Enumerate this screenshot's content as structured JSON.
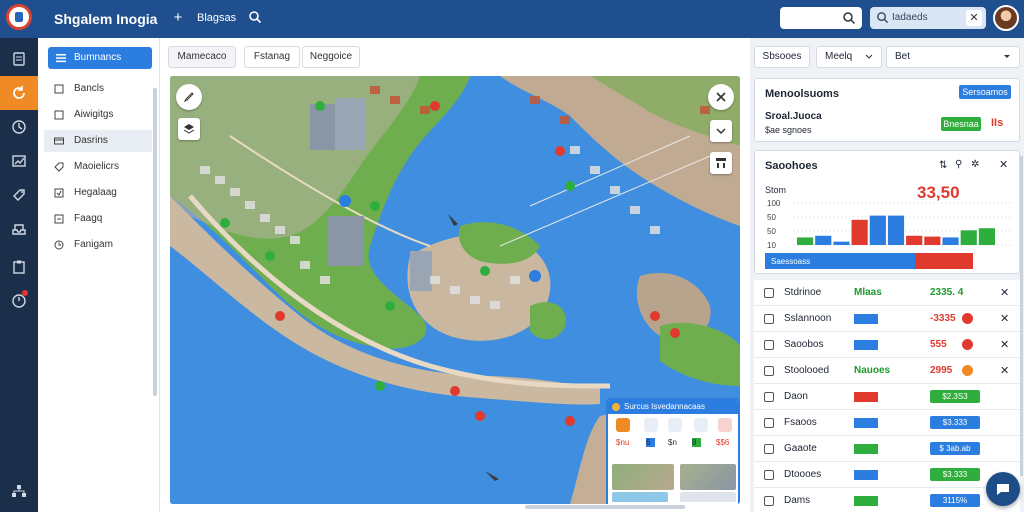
{
  "header": {
    "app_title": "Shgalem Inogia",
    "add_label": "+",
    "link_label": "Blagsas",
    "search_pill_label": "Iadaeds",
    "search_pill_clear": "✕"
  },
  "nav": {
    "primary_label": "Bumnancs",
    "items": [
      {
        "label": "Bancls",
        "icon": "square-icon"
      },
      {
        "label": "Aiwigitgs",
        "icon": "square-icon"
      },
      {
        "label": "Dasrins",
        "icon": "card-icon"
      },
      {
        "label": "Maoielicrs",
        "icon": "tag-icon"
      },
      {
        "label": "Hegalaag",
        "icon": "square-icon"
      },
      {
        "label": "Faagq",
        "icon": "square-icon"
      },
      {
        "label": "Fanigam",
        "icon": "clock-icon"
      }
    ]
  },
  "map": {
    "tabs": [
      "Mamecaco",
      "Fstanag",
      "Neggoice"
    ],
    "popup": {
      "title": "Surcus Isvedannacaas",
      "stats": [
        "$nu",
        "6",
        "$n",
        "8",
        "$$6"
      ]
    }
  },
  "right": {
    "btn_1": "Sbsooes",
    "select_1": "Meelq",
    "select_2": "Bet",
    "summary": {
      "title": "Menoolsuoms",
      "action": "Sersoamos",
      "subtitle_1": "Sroal.Juoca",
      "subtitle_2": "$ae sgnoes",
      "badge": "Bnesnaa",
      "value": "IIs"
    },
    "sales_card": {
      "title": "Saoohoes",
      "headline": "33,50",
      "y_label_top": "Stom",
      "y_ticks": [
        "100",
        "50",
        "50",
        "10"
      ],
      "legend_label": "Saessoass"
    },
    "rows": [
      {
        "name": "Stdrinoe",
        "text": "Mlaas",
        "value": "2335. 4",
        "value_color": "#1f9a2e"
      },
      {
        "name": "Sslannoon",
        "text": "",
        "value": "-3335",
        "value_color": "#e03a2f"
      },
      {
        "name": "Saoobos",
        "text": "",
        "value": "555",
        "value_color": "#e03a2f"
      },
      {
        "name": "Stoolooed",
        "text": "Nauoes",
        "value": "2995",
        "value_color": "#e03a2f"
      },
      {
        "name": "Daon",
        "text": "",
        "value": "$2.3S3",
        "value_color": ""
      },
      {
        "name": "Fsaoos",
        "text": "",
        "value": "$3.333",
        "value_color": ""
      },
      {
        "name": "Gaaote",
        "text": "",
        "value": "$ 3ab.ab",
        "value_color": ""
      },
      {
        "name": "Dtoooes",
        "text": "",
        "value": "$3.333",
        "value_color": ""
      },
      {
        "name": "Dams",
        "text": "",
        "value": "3115%",
        "value_color": "#1f9a2e"
      }
    ]
  },
  "chart_data": {
    "type": "bar",
    "title": "",
    "values": [
      18,
      22,
      8,
      60,
      70,
      70,
      22,
      20,
      18,
      35,
      40
    ],
    "colors": [
      "#2fae3d",
      "#2b7de0",
      "#2b7de0",
      "#e03a2f",
      "#2b7de0",
      "#2b7de0",
      "#e03a2f",
      "#e03a2f",
      "#2b7de0",
      "#2fae3d",
      "#2fae3d"
    ],
    "ylim": [
      0,
      100
    ]
  }
}
